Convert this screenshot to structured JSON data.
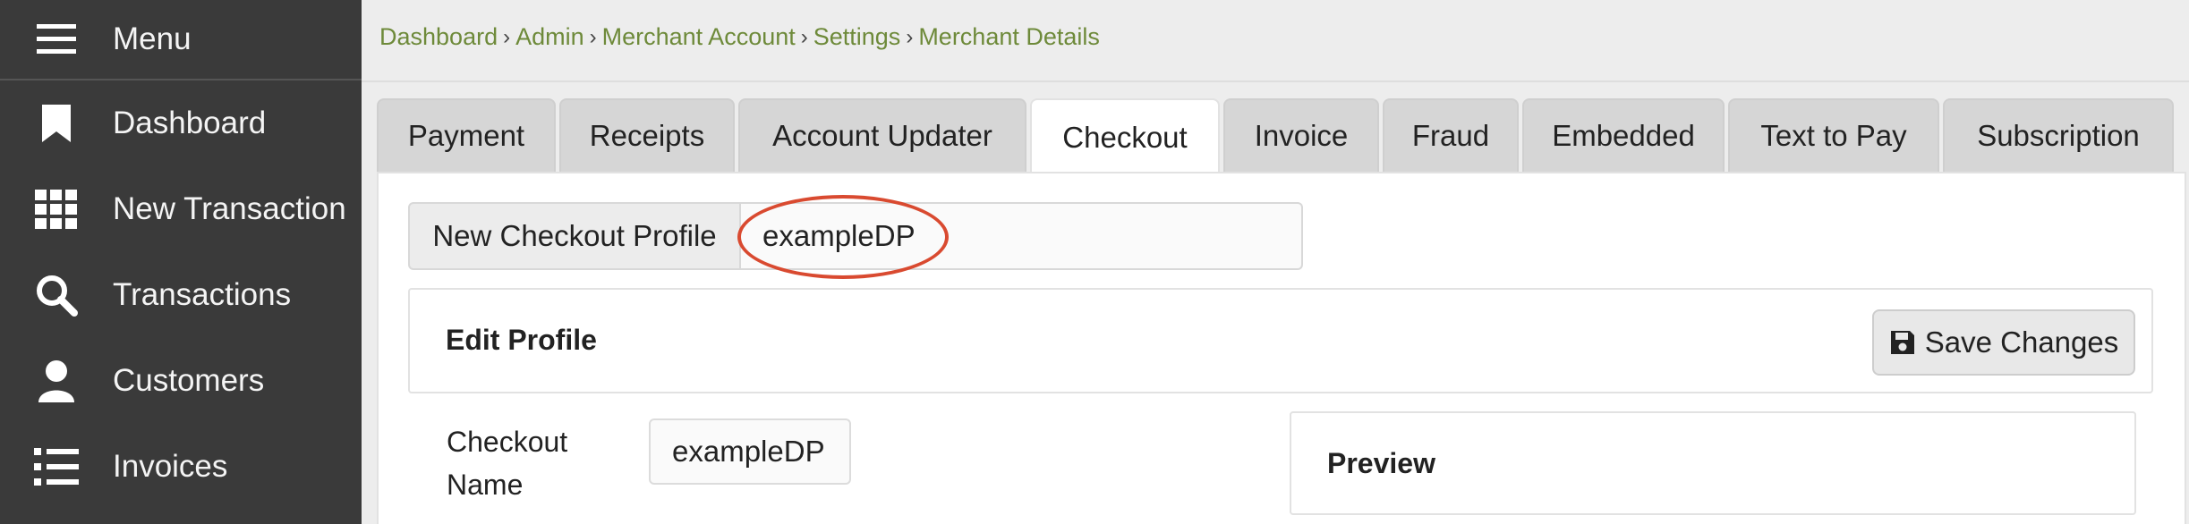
{
  "sidebar": {
    "menu_label": "Menu",
    "items": [
      {
        "label": "Dashboard",
        "icon": "bookmark-icon"
      },
      {
        "label": "New Transaction",
        "icon": "grid-icon"
      },
      {
        "label": "Transactions",
        "icon": "search-icon"
      },
      {
        "label": "Customers",
        "icon": "user-icon"
      },
      {
        "label": "Invoices",
        "icon": "list-icon"
      }
    ]
  },
  "breadcrumb": [
    "Dashboard",
    "Admin",
    "Merchant Account",
    "Settings",
    "Merchant Details"
  ],
  "tabs": [
    "Payment",
    "Receipts",
    "Account Updater",
    "Checkout",
    "Invoice",
    "Fraud",
    "Embedded",
    "Text to Pay",
    "Subscription"
  ],
  "active_tab": "Checkout",
  "profile": {
    "label": "New Checkout Profile",
    "value": "exampleDP"
  },
  "edit": {
    "title": "Edit Profile",
    "save_label": "Save Changes"
  },
  "form": {
    "checkout_name_label": "Checkout Name",
    "checkout_name_value": "exampleDP"
  },
  "preview": {
    "title": "Preview"
  },
  "colors": {
    "sidebar_bg": "#3a3a3a",
    "breadcrumb_link": "#6e8a3a",
    "highlight_circle": "#d94a30"
  }
}
